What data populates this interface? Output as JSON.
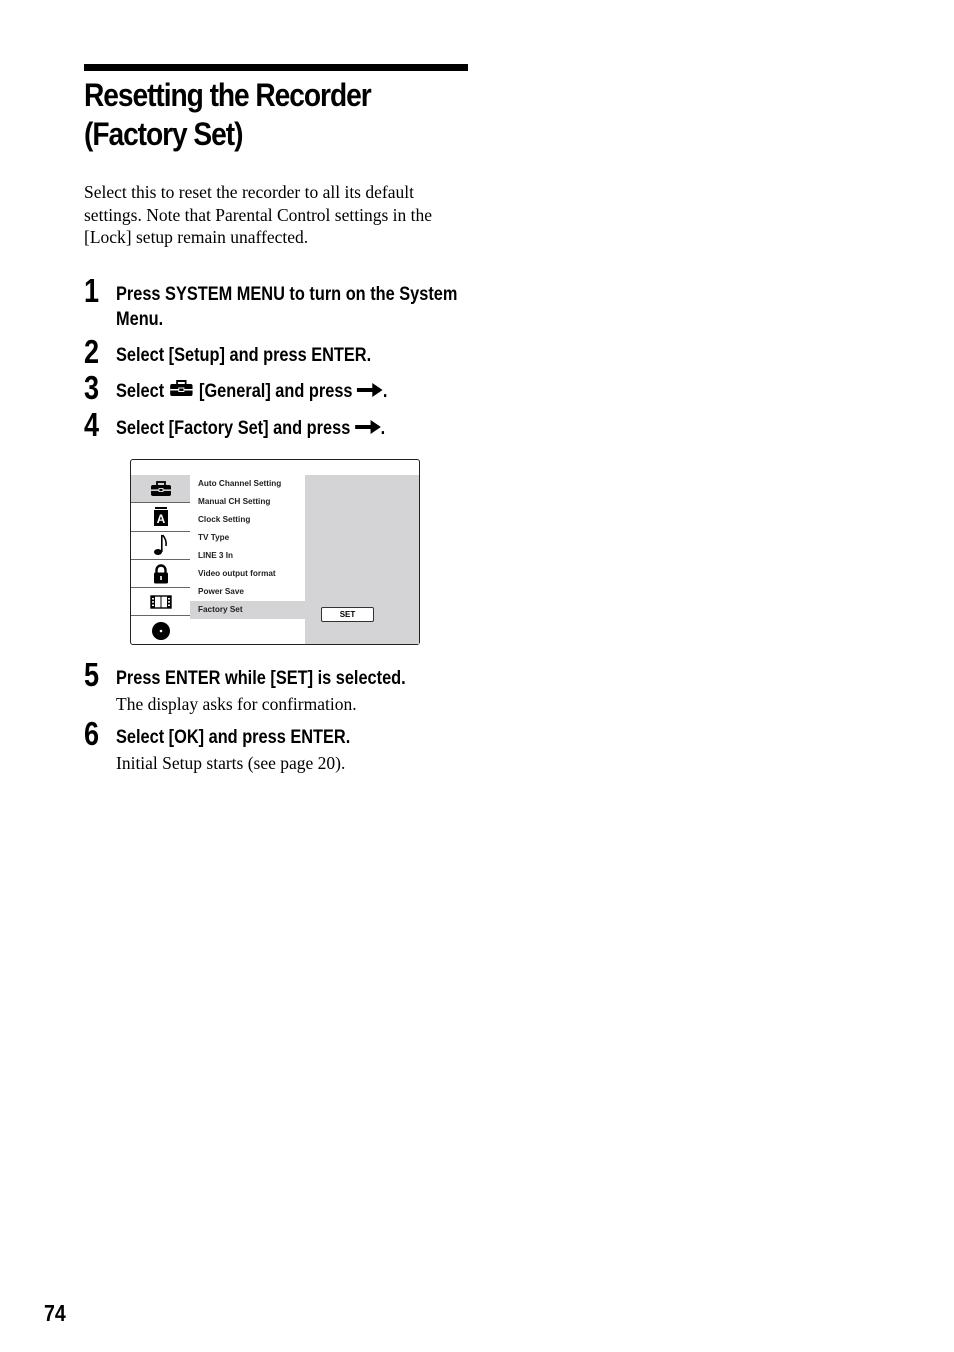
{
  "page": {
    "title_line1": "Resetting the Recorder",
    "title_line2": "(Factory Set)",
    "intro": "Select this to reset the recorder to all its default settings. Note that Parental Control settings in the [Lock] setup remain unaffected.",
    "page_number": "74"
  },
  "steps": [
    {
      "number": "1",
      "text_line1": "Press SYSTEM MENU to turn on the System",
      "text_line2": "Menu."
    },
    {
      "number": "2",
      "text": "Select [Setup] and press ENTER."
    },
    {
      "number": "3",
      "text_before_icon": "Select",
      "icon": "toolbox-icon",
      "text_after_icon": "[General] and press",
      "arrow": "right-arrow-icon",
      "end": "."
    },
    {
      "number": "4",
      "text": "Select [Factory Set] and press",
      "arrow": "right-arrow-icon",
      "end": "."
    },
    {
      "number": "5",
      "text": "Press ENTER while [SET] is selected.",
      "sub": "The display asks for confirmation."
    },
    {
      "number": "6",
      "text": "Select [OK] and press ENTER.",
      "sub": "Initial Setup starts (see page 20)."
    }
  ],
  "osd": {
    "tabs": [
      {
        "icon": "toolbox-icon",
        "name": "General",
        "active": true
      },
      {
        "icon": "language-a-icon",
        "name": "Language",
        "active": false
      },
      {
        "icon": "music-note-icon",
        "name": "Audio",
        "active": false
      },
      {
        "icon": "lock-icon",
        "name": "Lock",
        "active": false
      },
      {
        "icon": "film-icon",
        "name": "Video",
        "active": false
      },
      {
        "icon": "disc-icon",
        "name": "Disc",
        "active": false
      }
    ],
    "items": [
      "Auto Channel Setting",
      "Manual CH Setting",
      "Clock Setting",
      "TV Type",
      "LINE 3 In",
      "Video output format",
      "Power Save",
      "Factory Set"
    ],
    "selected_item": "Factory Set",
    "set_button": "SET",
    "colors": {
      "highlight": "#d4d4d6",
      "border": "#222222"
    }
  }
}
